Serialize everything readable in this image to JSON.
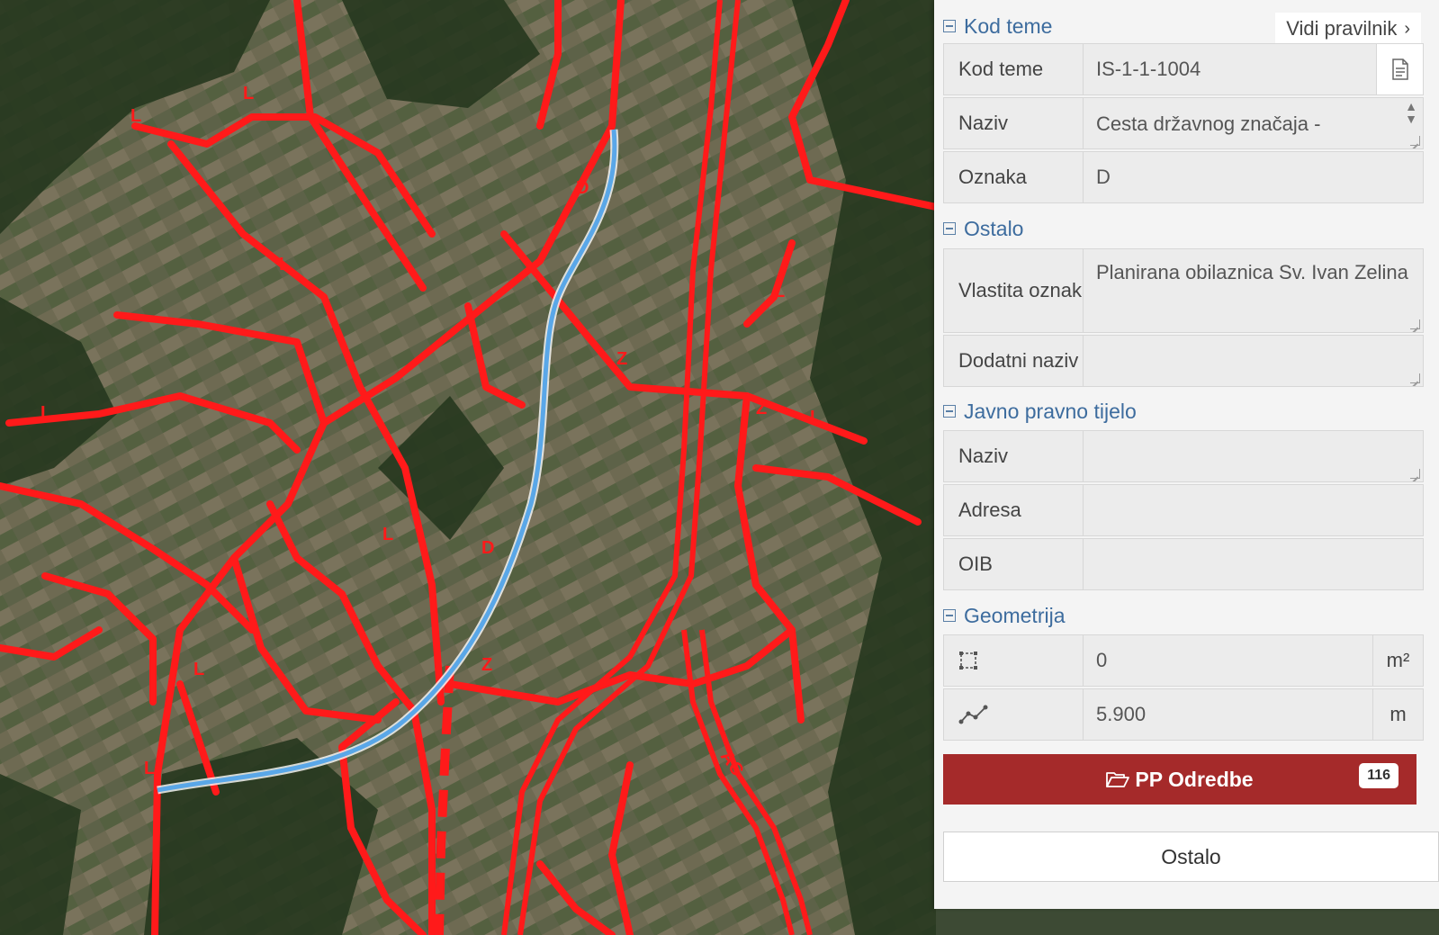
{
  "map": {
    "road_labels": [
      "D",
      "D",
      "Z",
      "L",
      "L",
      "L",
      "L",
      "Z",
      "AC",
      "L",
      "Z",
      "L",
      "L",
      "L",
      "L"
    ],
    "colors": {
      "roads": "#ff1a1a",
      "selected": "#5aa7e8",
      "imagery": "#3f5236"
    }
  },
  "panel": {
    "kod_teme_section": "Kod teme",
    "vidi_pravilnik": "Vidi pravilnik",
    "kod_teme_label": "Kod teme",
    "kod_teme_value": "IS-1-1-1004",
    "naziv_label": "Naziv",
    "naziv_value": "Cesta državnog značaja - ",
    "oznaka_label": "Oznaka",
    "oznaka_value": "D",
    "ostalo_section": "Ostalo",
    "vlastita_label": "Vlastita oznaka",
    "vlastita_value": "Planirana obilaznica Sv. Ivan Zelina",
    "dodatni_label": "Dodatni naziv",
    "dodatni_value": "",
    "jpt_section": "Javno pravno tijelo",
    "jpt_naziv_label": "Naziv",
    "jpt_naziv_value": "",
    "adresa_label": "Adresa",
    "adresa_value": "",
    "oib_label": "OIB",
    "oib_value": "",
    "geometrija_section": "Geometrija",
    "area_value": "0",
    "area_unit": "m²",
    "length_value": "5.900",
    "length_unit": "m",
    "pp_odredbe_label": "PP Odredbe",
    "pp_odredbe_count": "116",
    "ostalo_button": "Ostalo"
  }
}
